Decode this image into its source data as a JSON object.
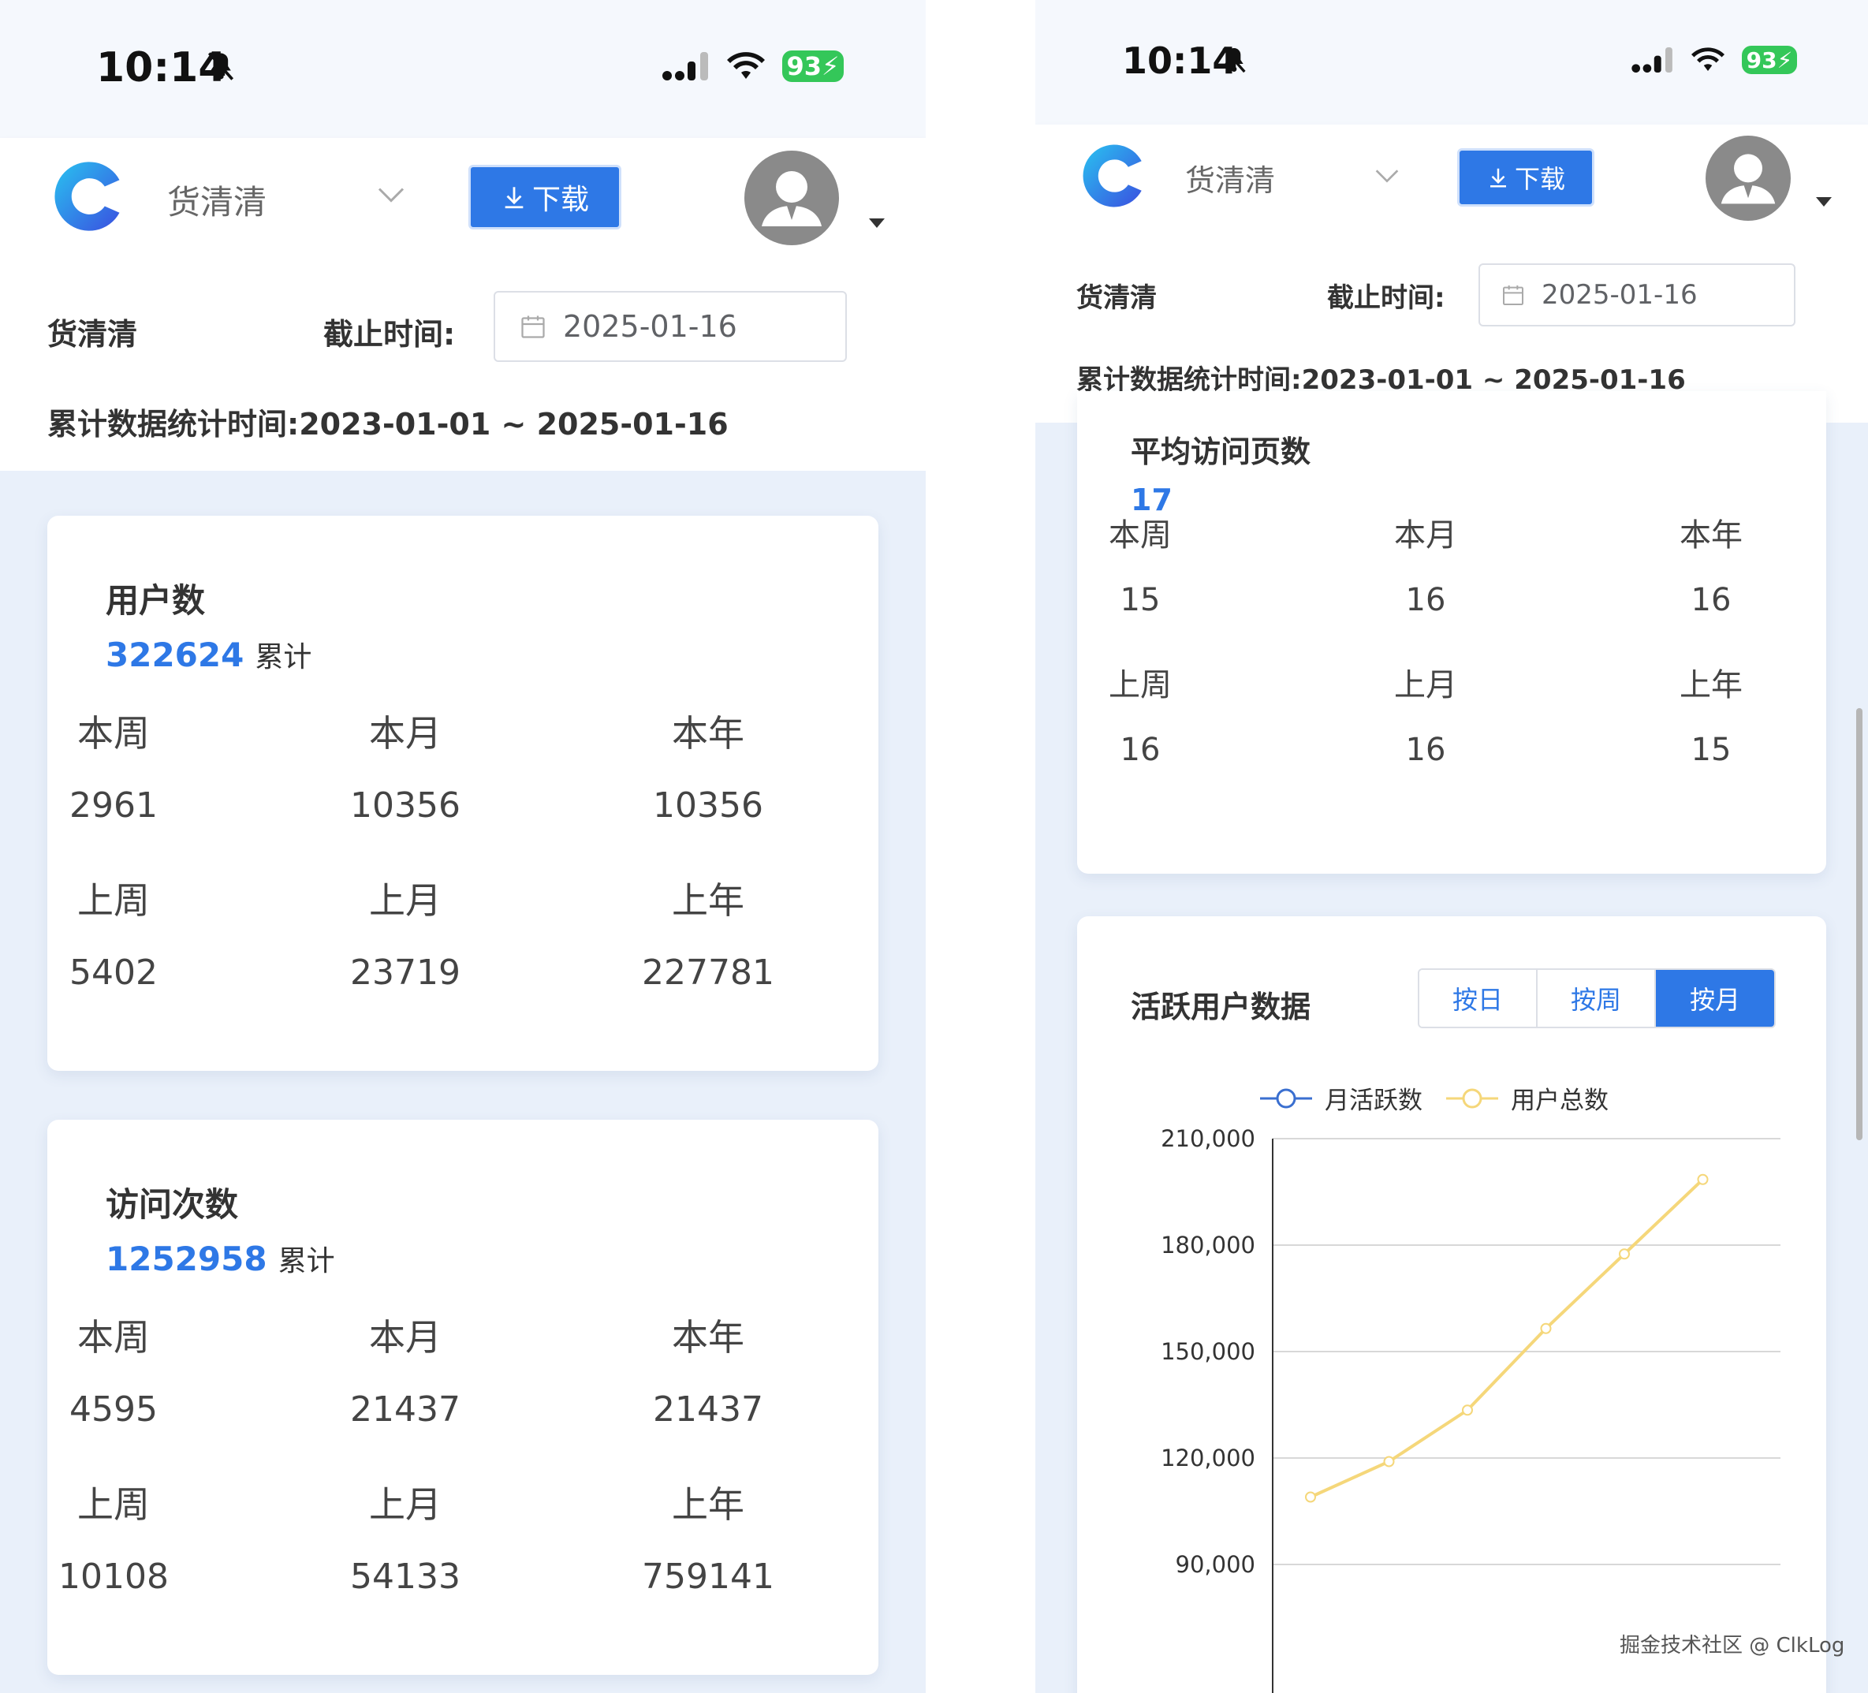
{
  "status": {
    "time": "10:14",
    "battery": "93"
  },
  "header": {
    "app_name": "货清清",
    "download_label": "下载"
  },
  "filter": {
    "org_label": "货清清",
    "deadline_label": "截止时间:",
    "deadline_value": "2025-01-16",
    "range_label": "累计数据统计时间:",
    "range_value": "2023-01-01 ~ 2025-01-16"
  },
  "cards": {
    "users": {
      "title": "用户数",
      "total": "322624",
      "total_suffix": "累计",
      "stats": [
        {
          "label": "本周",
          "value": "2961"
        },
        {
          "label": "本月",
          "value": "10356"
        },
        {
          "label": "本年",
          "value": "10356"
        },
        {
          "label": "上周",
          "value": "5402"
        },
        {
          "label": "上月",
          "value": "23719"
        },
        {
          "label": "上年",
          "value": "227781"
        }
      ]
    },
    "visits": {
      "title": "访问次数",
      "total": "1252958",
      "total_suffix": "累计",
      "stats": [
        {
          "label": "本周",
          "value": "4595"
        },
        {
          "label": "本月",
          "value": "21437"
        },
        {
          "label": "本年",
          "value": "21437"
        },
        {
          "label": "上周",
          "value": "10108"
        },
        {
          "label": "上月",
          "value": "54133"
        },
        {
          "label": "上年",
          "value": "759141"
        }
      ]
    },
    "avg_pages": {
      "title": "平均访问页数",
      "total": "17",
      "stats": [
        {
          "label": "本周",
          "value": "15"
        },
        {
          "label": "本月",
          "value": "16"
        },
        {
          "label": "本年",
          "value": "16"
        },
        {
          "label": "上周",
          "value": "16"
        },
        {
          "label": "上月",
          "value": "16"
        },
        {
          "label": "上年",
          "value": "15"
        }
      ]
    },
    "active": {
      "title": "活跃用户数据",
      "tabs": [
        {
          "label": "按日",
          "active": false
        },
        {
          "label": "按周",
          "active": false
        },
        {
          "label": "按月",
          "active": true
        }
      ]
    }
  },
  "chart_data": {
    "type": "line",
    "title": "",
    "xlabel": "",
    "ylabel": "",
    "yticks": [
      "210,000",
      "180,000",
      "150,000",
      "120,000",
      "90,000"
    ],
    "ylim": [
      90000,
      210000
    ],
    "legend": "top-center",
    "grid": true,
    "series": [
      {
        "name": "月活跃数",
        "color": "#3a6fd0",
        "values": []
      },
      {
        "name": "用户总数",
        "color": "#f5d77a",
        "values": [
          109000,
          119000,
          133500,
          156500,
          177500,
          198500
        ]
      }
    ]
  },
  "watermark": "掘金技术社区 @ ClkLog",
  "colors": {
    "accent": "#2e78e6",
    "page_bg": "#e9f0fa"
  }
}
